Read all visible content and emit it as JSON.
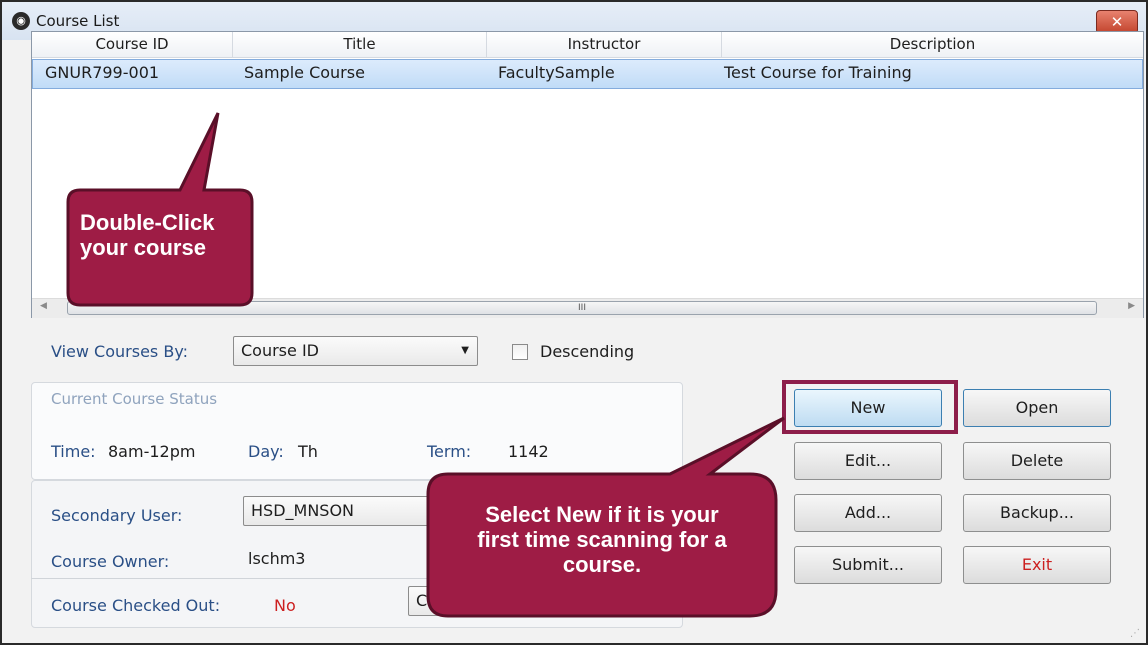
{
  "window": {
    "title": "Course List",
    "close_symbol": "✕"
  },
  "list": {
    "columns": [
      "Course ID",
      "Title",
      "Instructor",
      "Description"
    ],
    "rows": [
      {
        "course_id": "GNUR799-001",
        "title": "Sample Course",
        "instructor": "FacultySample",
        "description": "Test Course for Training"
      }
    ],
    "scroll_grip": "III"
  },
  "view": {
    "label": "View Courses By:",
    "selected": "Course ID",
    "descending_label": "Descending",
    "descending_checked": false
  },
  "status": {
    "heading": "Current Course Status",
    "time_label": "Time:",
    "time_value": "8am-12pm",
    "day_label": "Day:",
    "day_value": "Th",
    "term_label": "Term:",
    "term_value": "1142",
    "secondary_user_label": "Secondary User:",
    "secondary_user_value": "HSD_MNSON",
    "owner_label": "Course Owner:",
    "owner_value": "lschm3",
    "checked_out_label": "Course Checked Out:",
    "checked_out_value": "No",
    "check_button_partial": "Ch"
  },
  "buttons": {
    "new": "New",
    "open": "Open",
    "edit": "Edit...",
    "delete": "Delete",
    "add": "Add...",
    "backup": "Backup...",
    "submit": "Submit...",
    "exit": "Exit"
  },
  "callouts": {
    "double_click": [
      "Double-Click",
      "your course"
    ],
    "select_new": [
      "Select New if it is your",
      "first time scanning for a",
      "course."
    ]
  },
  "colors": {
    "callout": "#9e1c45",
    "exit_text": "#cc1f1f",
    "status_no": "#cc1f1f",
    "label_blue": "#2a4f86"
  }
}
